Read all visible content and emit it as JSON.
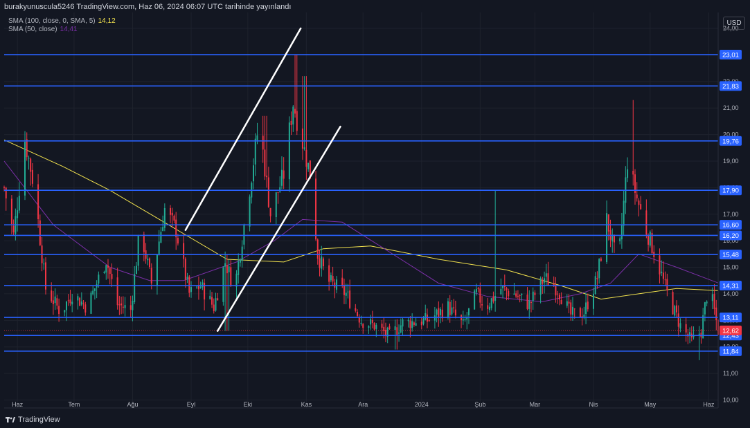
{
  "header": "burakyunuscula5246 TradingView.com, Haz 06, 2024 06:07 UTC tarihinde yayınlandı",
  "currency": "USD",
  "brand": "TradingView",
  "indicators": [
    {
      "label": "SMA (100, close, 0, SMA, 5)",
      "value": "14,12",
      "color": "#f2e24e"
    },
    {
      "label": "SMA (50, close)",
      "value": "14,41",
      "color": "#7b2fa8"
    }
  ],
  "colors": {
    "up": "#22ab94",
    "down": "#f23645",
    "level": "#2962ff",
    "trend": "#ffffff",
    "last_price": "#f23645"
  },
  "chart_data": {
    "type": "candlestick",
    "x_range": [
      "2023-05-25",
      "2024-06-06"
    ],
    "y_range": [
      9.7,
      24.6
    ],
    "y_ticks": [
      {
        "value": 10,
        "label": "10,00"
      },
      {
        "value": 11,
        "label": "11,00"
      },
      {
        "value": 12,
        "label": "12,00"
      },
      {
        "value": 13,
        "label": "13,00"
      },
      {
        "value": 14,
        "label": "14,00"
      },
      {
        "value": 15,
        "label": "15,00"
      },
      {
        "value": 16,
        "label": "16,00"
      },
      {
        "value": 17,
        "label": "17,00"
      },
      {
        "value": 18,
        "label": "18,00"
      },
      {
        "value": 19,
        "label": "19,00"
      },
      {
        "value": 20,
        "label": "20,00"
      },
      {
        "value": 21,
        "label": "21,00"
      },
      {
        "value": 22,
        "label": "22,00"
      },
      {
        "value": 24,
        "label": "24,00"
      }
    ],
    "x_ticks": [
      {
        "date": "2023-06-01",
        "label": "Haz"
      },
      {
        "date": "2023-07-01",
        "label": "Tem"
      },
      {
        "date": "2023-08-01",
        "label": "Ağu"
      },
      {
        "date": "2023-09-01",
        "label": "Eyl"
      },
      {
        "date": "2023-10-01",
        "label": "Eki"
      },
      {
        "date": "2023-11-01",
        "label": "Kas"
      },
      {
        "date": "2023-12-01",
        "label": "Ara"
      },
      {
        "date": "2024-01-01",
        "label": "2024"
      },
      {
        "date": "2024-02-01",
        "label": "Şub"
      },
      {
        "date": "2024-03-01",
        "label": "Mar"
      },
      {
        "date": "2024-04-01",
        "label": "Nis"
      },
      {
        "date": "2024-05-01",
        "label": "May"
      },
      {
        "date": "2024-06-01",
        "label": "Haz"
      }
    ],
    "horizontal_levels": [
      {
        "value": 23.01,
        "label": "23,01"
      },
      {
        "value": 21.83,
        "label": "21,83"
      },
      {
        "value": 19.76,
        "label": "19,76"
      },
      {
        "value": 17.9,
        "label": "17,90"
      },
      {
        "value": 16.6,
        "label": "16,60"
      },
      {
        "value": 16.2,
        "label": "16,20"
      },
      {
        "value": 15.48,
        "label": "15,48"
      },
      {
        "value": 14.31,
        "label": "14,31"
      },
      {
        "value": 13.11,
        "label": "13,11"
      },
      {
        "value": 12.43,
        "label": "12,43"
      },
      {
        "value": 11.84,
        "label": "11,84"
      }
    ],
    "last_price": {
      "value": 12.62,
      "label": "12,62"
    },
    "trend_lines": [
      {
        "from": {
          "date": "2023-08-29",
          "value": 16.4
        },
        "to": {
          "date": "2023-10-29",
          "value": 24.0
        }
      },
      {
        "from": {
          "date": "2023-09-15",
          "value": 12.6
        },
        "to": {
          "date": "2023-11-19",
          "value": 20.3
        }
      }
    ],
    "price_path": [
      [
        "2023-05-25",
        18.0
      ],
      [
        "2023-05-30",
        16.2
      ],
      [
        "2023-06-05",
        19.8
      ],
      [
        "2023-06-10",
        18.0
      ],
      [
        "2023-06-16",
        14.2
      ],
      [
        "2023-06-24",
        13.3
      ],
      [
        "2023-06-30",
        14.0
      ],
      [
        "2023-07-08",
        13.5
      ],
      [
        "2023-07-18",
        15.3
      ],
      [
        "2023-07-24",
        13.6
      ],
      [
        "2023-07-31",
        13.4
      ],
      [
        "2023-08-05",
        16.5
      ],
      [
        "2023-08-11",
        14.4
      ],
      [
        "2023-08-18",
        17.2
      ],
      [
        "2023-08-24",
        16.4
      ],
      [
        "2023-08-31",
        14.0
      ],
      [
        "2023-09-06",
        14.3
      ],
      [
        "2023-09-13",
        13.5
      ],
      [
        "2023-09-19",
        15.2
      ],
      [
        "2023-09-24",
        14.2
      ],
      [
        "2023-10-02",
        18.0
      ],
      [
        "2023-10-07",
        20.5
      ],
      [
        "2023-10-13",
        17.0
      ],
      [
        "2023-10-20",
        18.5
      ],
      [
        "2023-10-25",
        21.2
      ],
      [
        "2023-10-29",
        20.0
      ],
      [
        "2023-11-03",
        18.5
      ],
      [
        "2023-11-07",
        15.5
      ],
      [
        "2023-11-12",
        14.5
      ],
      [
        "2023-11-22",
        14.0
      ],
      [
        "2023-11-30",
        13.0
      ],
      [
        "2023-12-07",
        12.8
      ],
      [
        "2023-12-15",
        12.4
      ],
      [
        "2023-12-22",
        12.9
      ],
      [
        "2024-01-04",
        13.0
      ],
      [
        "2024-01-15",
        13.5
      ],
      [
        "2024-01-23",
        12.8
      ],
      [
        "2024-01-30",
        14.0
      ],
      [
        "2024-02-04",
        13.5
      ],
      [
        "2024-02-12",
        14.2
      ],
      [
        "2024-02-19",
        14.0
      ],
      [
        "2024-02-27",
        13.6
      ],
      [
        "2024-03-06",
        14.6
      ],
      [
        "2024-03-13",
        14.2
      ],
      [
        "2024-03-20",
        13.2
      ],
      [
        "2024-03-27",
        13.3
      ],
      [
        "2024-04-03",
        14.6
      ],
      [
        "2024-04-08",
        16.8
      ],
      [
        "2024-04-14",
        15.0
      ],
      [
        "2024-04-19",
        19.0
      ],
      [
        "2024-04-24",
        17.6
      ],
      [
        "2024-04-29",
        16.4
      ],
      [
        "2024-05-04",
        15.4
      ],
      [
        "2024-05-10",
        14.0
      ],
      [
        "2024-05-17",
        12.8
      ],
      [
        "2024-05-23",
        12.2
      ],
      [
        "2024-05-28",
        12.6
      ],
      [
        "2024-06-01",
        14.4
      ],
      [
        "2024-06-06",
        12.62
      ]
    ],
    "spikes": [
      {
        "date": "2023-10-27",
        "value": 23.0
      },
      {
        "date": "2023-10-31",
        "value": 22.2
      },
      {
        "date": "2024-04-21",
        "value": 21.3
      },
      {
        "date": "2024-02-10",
        "value": 17.9
      },
      {
        "date": "2023-10-10",
        "value": 20.7
      }
    ],
    "dips": [
      {
        "date": "2024-05-26",
        "value": 11.5
      },
      {
        "date": "2023-12-18",
        "value": 11.9
      },
      {
        "date": "2023-09-20",
        "value": 12.6
      }
    ],
    "series": [
      {
        "name": "SMA (100, close, 0, SMA, 5)",
        "color": "#f2e24e",
        "path": [
          [
            "2023-05-25",
            19.8
          ],
          [
            "2023-06-25",
            18.8
          ],
          [
            "2023-07-20",
            17.9
          ],
          [
            "2023-08-20",
            16.6
          ],
          [
            "2023-09-20",
            15.3
          ],
          [
            "2023-10-20",
            15.2
          ],
          [
            "2023-11-10",
            15.7
          ],
          [
            "2023-12-05",
            15.8
          ],
          [
            "2024-01-10",
            15.3
          ],
          [
            "2024-02-15",
            14.9
          ],
          [
            "2024-03-15",
            14.3
          ],
          [
            "2024-04-05",
            13.8
          ],
          [
            "2024-04-25",
            14.0
          ],
          [
            "2024-05-15",
            14.2
          ],
          [
            "2024-06-06",
            14.12
          ]
        ]
      },
      {
        "name": "SMA (50, close)",
        "color": "#7b2fa8",
        "path": [
          [
            "2023-05-25",
            19.0
          ],
          [
            "2023-06-20",
            16.6
          ],
          [
            "2023-07-20",
            15.0
          ],
          [
            "2023-08-10",
            14.5
          ],
          [
            "2023-08-28",
            14.5
          ],
          [
            "2023-09-25",
            15.2
          ],
          [
            "2023-10-15",
            16.0
          ],
          [
            "2023-10-30",
            16.8
          ],
          [
            "2023-11-20",
            16.7
          ],
          [
            "2023-12-10",
            15.8
          ],
          [
            "2024-01-10",
            14.4
          ],
          [
            "2024-02-05",
            13.9
          ],
          [
            "2024-03-05",
            13.7
          ],
          [
            "2024-03-25",
            14.0
          ],
          [
            "2024-04-10",
            14.4
          ],
          [
            "2024-04-25",
            15.5
          ],
          [
            "2024-05-15",
            15.0
          ],
          [
            "2024-06-06",
            14.41
          ]
        ]
      }
    ]
  }
}
